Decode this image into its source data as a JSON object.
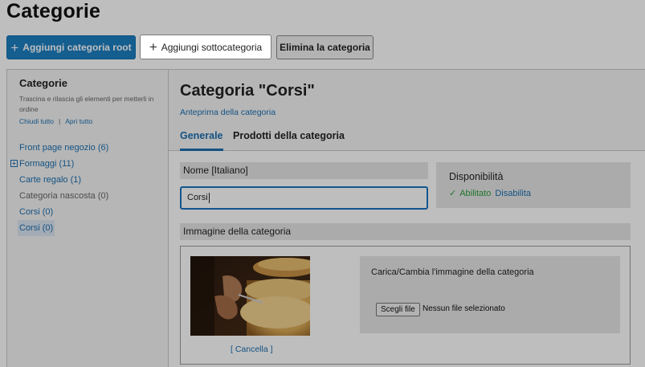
{
  "page": {
    "title": "Categorie"
  },
  "toolbar": {
    "add_root_label": "Aggiungi categoria root",
    "add_sub_label": "Aggiungi sottocategoria",
    "delete_label": "Elimina la categoria"
  },
  "sidebar": {
    "title": "Categorie",
    "help": "Trascina e rilascia gli elementi per metterli in ordine",
    "collapse_all": "Chiudi tutto",
    "separator": "|",
    "expand_all": "Apri tutto",
    "items": [
      {
        "label": "Front page negozio (6)"
      },
      {
        "label": "Formaggi (11)",
        "expand_icon": "⊞"
      },
      {
        "label": "Carte regalo (1)"
      },
      {
        "label": "Categoria nascosta (0)"
      },
      {
        "label": "Corsi (0)"
      },
      {
        "label": "Corsi (0)"
      }
    ]
  },
  "main": {
    "title": "Categoria \"Corsi\"",
    "preview_link": "Anteprima della categoria",
    "tabs": [
      {
        "label": "Generale"
      },
      {
        "label": "Prodotti della categoria"
      }
    ],
    "name_label": "Nome [Italiano]",
    "name_value": "Corsi",
    "availability": {
      "title": "Disponibilità",
      "enabled": "Abilitato",
      "disable": "Disabilita"
    },
    "image": {
      "label": "Immagine della categoria",
      "cancel": "[ Cancella ]",
      "upload_title": "Carica/Cambia l'immagine della categoria",
      "file_button": "Scegli file",
      "file_status": "Nessun file selezionato"
    }
  },
  "colors": {
    "accent": "#1b7fc2",
    "link": "#1b6fb0",
    "enabled_green": "#2a9d3a",
    "overlay": "rgba(0,0,0,0.255)"
  },
  "icons": {
    "plus": "+",
    "check": "✓"
  }
}
